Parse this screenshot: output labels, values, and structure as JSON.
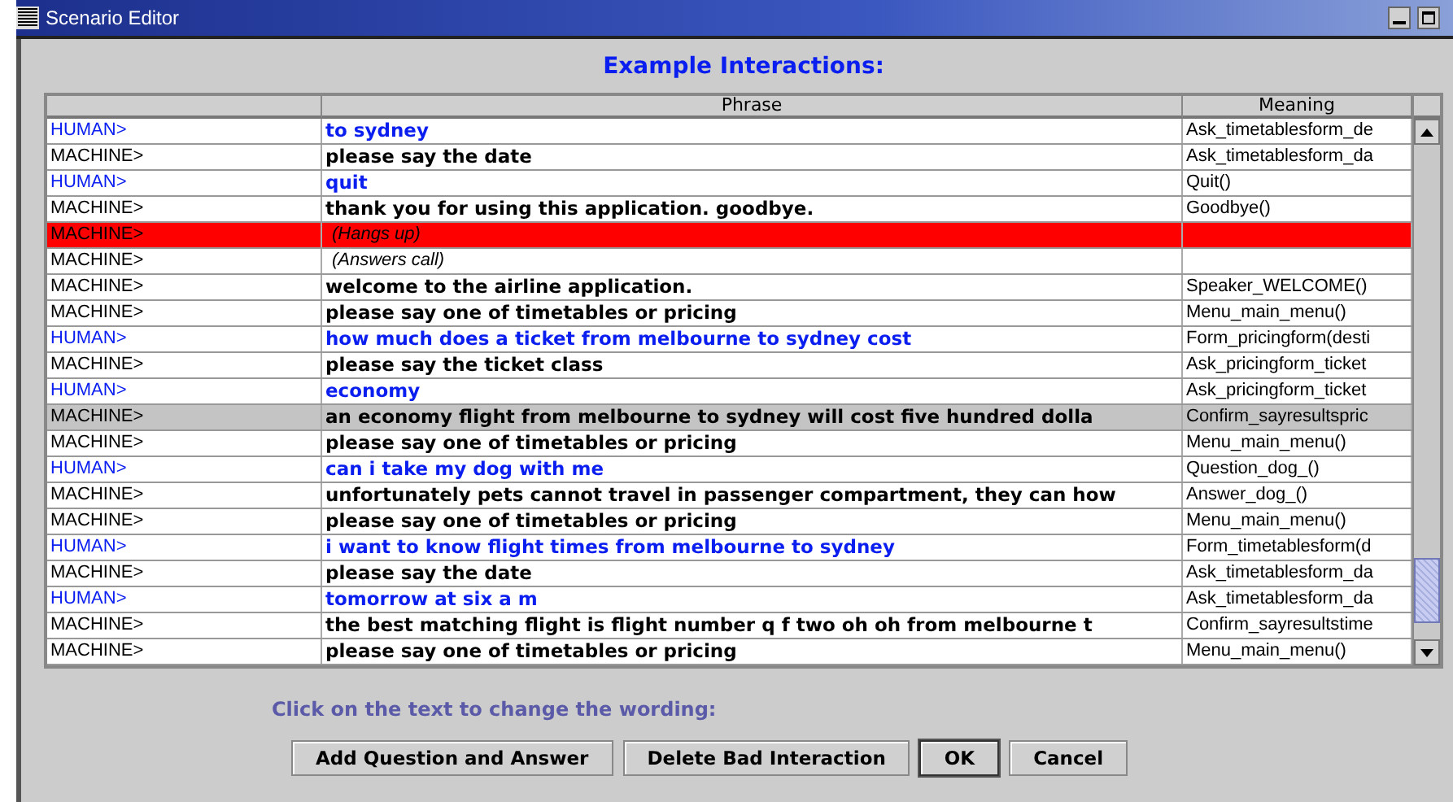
{
  "window": {
    "title": "Scenario Editor"
  },
  "heading": "Example Interactions:",
  "table": {
    "columns": [
      "",
      "Phrase",
      "Meaning"
    ],
    "rows": [
      {
        "speaker": "HUMAN>",
        "phrase": "to sydney",
        "meaning": "Ask_timetablesform_de",
        "kind": "human",
        "flagged": false,
        "selected": false
      },
      {
        "speaker": "MACHINE>",
        "phrase": "please say the date",
        "meaning": "Ask_timetablesform_da",
        "kind": "machine",
        "flagged": false,
        "selected": false
      },
      {
        "speaker": "HUMAN>",
        "phrase": "quit",
        "meaning": "Quit()",
        "kind": "human",
        "flagged": false,
        "selected": false
      },
      {
        "speaker": "MACHINE>",
        "phrase": "thank you for using this application. goodbye.",
        "meaning": "Goodbye()",
        "kind": "machine",
        "flagged": false,
        "selected": false
      },
      {
        "speaker": "MACHINE>",
        "phrase": "(Hangs up)",
        "kind": "event",
        "flagged": true,
        "selected": false
      },
      {
        "speaker": "MACHINE>",
        "phrase": "(Answers call)",
        "kind": "event",
        "flagged": false,
        "selected": false
      },
      {
        "speaker": "MACHINE>",
        "phrase": "welcome to the airline application.",
        "meaning": "Speaker_WELCOME()",
        "kind": "machine",
        "flagged": false,
        "selected": false
      },
      {
        "speaker": "MACHINE>",
        "phrase": "please say one of timetables or pricing",
        "meaning": "Menu_main_menu()",
        "kind": "machine",
        "flagged": false,
        "selected": false
      },
      {
        "speaker": "HUMAN>",
        "phrase": "how much does a ticket from melbourne to sydney cost",
        "meaning": "Form_pricingform(desti",
        "kind": "human",
        "flagged": false,
        "selected": false
      },
      {
        "speaker": "MACHINE>",
        "phrase": "please say the ticket class",
        "meaning": "Ask_pricingform_ticket",
        "kind": "machine",
        "flagged": false,
        "selected": false
      },
      {
        "speaker": "HUMAN>",
        "phrase": "economy",
        "meaning": "Ask_pricingform_ticket",
        "kind": "human",
        "flagged": false,
        "selected": false
      },
      {
        "speaker": "MACHINE>",
        "phrase": "an economy flight from melbourne to sydney will cost five hundred dolla",
        "meaning": "Confirm_sayresultspric",
        "kind": "machine",
        "flagged": false,
        "selected": true
      },
      {
        "speaker": "MACHINE>",
        "phrase": "please say one of timetables or pricing",
        "meaning": "Menu_main_menu()",
        "kind": "machine",
        "flagged": false,
        "selected": false
      },
      {
        "speaker": "HUMAN>",
        "phrase": "can i take my dog with me",
        "meaning": "Question_dog_()",
        "kind": "human",
        "flagged": false,
        "selected": false
      },
      {
        "speaker": "MACHINE>",
        "phrase": "unfortunately pets cannot travel in passenger compartment, they can how",
        "meaning": "Answer_dog_()",
        "kind": "machine",
        "flagged": false,
        "selected": false
      },
      {
        "speaker": "MACHINE>",
        "phrase": "please say one of timetables or pricing",
        "meaning": "Menu_main_menu()",
        "kind": "machine",
        "flagged": false,
        "selected": false
      },
      {
        "speaker": "HUMAN>",
        "phrase": "i want to know flight times from melbourne to sydney",
        "meaning": "Form_timetablesform(d",
        "kind": "human",
        "flagged": false,
        "selected": false
      },
      {
        "speaker": "MACHINE>",
        "phrase": "please say the date",
        "meaning": "Ask_timetablesform_da",
        "kind": "machine",
        "flagged": false,
        "selected": false
      },
      {
        "speaker": "HUMAN>",
        "phrase": "tomorrow at six a m",
        "meaning": "Ask_timetablesform_da",
        "kind": "human",
        "flagged": false,
        "selected": false
      },
      {
        "speaker": "MACHINE>",
        "phrase": "the best matching flight is flight number q f two oh oh from melbourne t",
        "meaning": "Confirm_sayresultstime",
        "kind": "machine",
        "flagged": false,
        "selected": false
      },
      {
        "speaker": "MACHINE>",
        "phrase": "please say one of timetables or pricing",
        "meaning": "Menu_main_menu()",
        "kind": "machine",
        "flagged": false,
        "selected": false
      }
    ]
  },
  "hint": "Click on the text to change the wording:",
  "buttons": [
    {
      "label": "Add Question and Answer",
      "default": false
    },
    {
      "label": "Delete Bad Interaction",
      "default": false
    },
    {
      "label": "OK",
      "default": true
    },
    {
      "label": "Cancel",
      "default": false
    }
  ]
}
